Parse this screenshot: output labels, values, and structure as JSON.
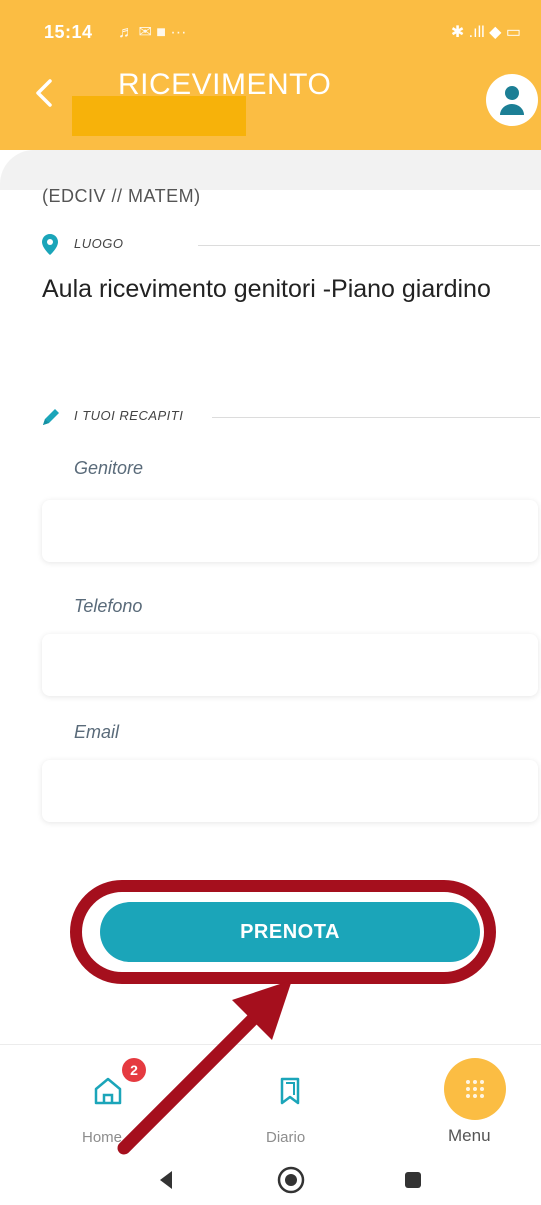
{
  "status_bar": {
    "time": "15:14",
    "left_icons": "♬ ✉ ■ ···",
    "right_icons": "✱ .ıll ◆ ▭"
  },
  "header": {
    "title": "RICEVIMENTO"
  },
  "content": {
    "class_code": "(EDCIV // MATEM)",
    "location_section_label": "LUOGO",
    "location_text": "Aula ricevimento genitori -Piano giardino",
    "contacts_section_label": "I TUOI RECAPITI"
  },
  "form": {
    "parent_label": "Genitore",
    "parent_value": "",
    "phone_label": "Telefono",
    "phone_value": "",
    "email_label": "Email",
    "email_value": ""
  },
  "actions": {
    "book_label": "PRENOTA"
  },
  "bottom_nav": {
    "home_label": "Home",
    "home_badge": "2",
    "diary_label": "Diario",
    "menu_label": "Menu"
  },
  "colors": {
    "accent": "#fbbd43",
    "button": "#1ba5b9",
    "highlight": "#a50f1d"
  }
}
